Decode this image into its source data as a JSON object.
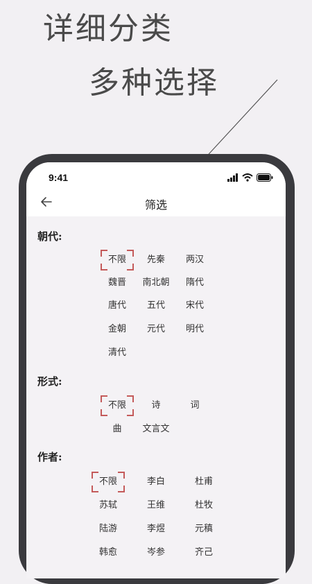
{
  "promo": {
    "line1": "详细分类",
    "line2": "多种选择"
  },
  "status_bar": {
    "time": "9:41",
    "icons": [
      "signal-icon",
      "wifi-icon",
      "battery-icon"
    ]
  },
  "nav": {
    "title": "筛选",
    "back_icon": "arrow-left-icon"
  },
  "accent_color": "#c45a5a",
  "sections": {
    "dynasty": {
      "label": "朝代:",
      "options": [
        "不限",
        "先秦",
        "两汉",
        "魏晋",
        "南北朝",
        "隋代",
        "唐代",
        "五代",
        "宋代",
        "金朝",
        "元代",
        "明代",
        "清代"
      ],
      "selected": "不限"
    },
    "form": {
      "label": "形式:",
      "options": [
        "不限",
        "诗",
        "词",
        "曲",
        "文言文"
      ],
      "selected": "不限"
    },
    "author": {
      "label": "作者:",
      "options": [
        "不限",
        "李白",
        "杜甫",
        "苏轼",
        "王维",
        "杜牧",
        "陆游",
        "李煜",
        "元稹",
        "韩愈",
        "岑参",
        "齐己"
      ],
      "selected": "不限"
    }
  }
}
